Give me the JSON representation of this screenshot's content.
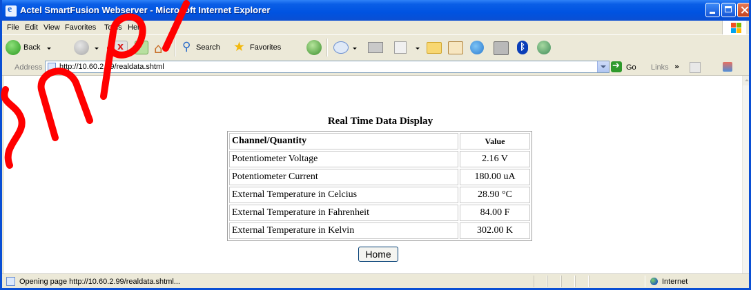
{
  "window": {
    "title": "Actel SmartFusion Webserver - Microsoft Internet Explorer",
    "title_bar_color": "#0054e3"
  },
  "menu": {
    "items": [
      {
        "label": "File"
      },
      {
        "label": "Edit"
      },
      {
        "label": "View"
      },
      {
        "label": "Favorites"
      },
      {
        "label": "Tools"
      },
      {
        "label": "Help"
      }
    ]
  },
  "toolbar": {
    "back_label": "Back",
    "search_label": "Search",
    "favorites_label": "Favorites"
  },
  "address": {
    "label": "Address",
    "url": "http://10.60.2.99/realdata.shtml",
    "go_label": "Go",
    "links_label": "Links"
  },
  "page": {
    "heading": "Real Time Data Display",
    "table": {
      "headers": [
        "Channel/Quantity",
        "Value"
      ],
      "rows": [
        [
          "Potentiometer Voltage",
          "2.16 V"
        ],
        [
          "Potentiometer Current",
          "180.00 uA"
        ],
        [
          "External Temperature in Celcius",
          "28.90 °C"
        ],
        [
          "External Temperature in Fahrenheit",
          "84.00 F"
        ],
        [
          "External Temperature in Kelvin",
          "302.00 K"
        ]
      ]
    },
    "home_button": "Home"
  },
  "status": {
    "text": "Opening page http://10.60.2.99/realdata.shtml...",
    "zone": "Internet"
  },
  "watermark": {
    "color": "#ff0000"
  }
}
